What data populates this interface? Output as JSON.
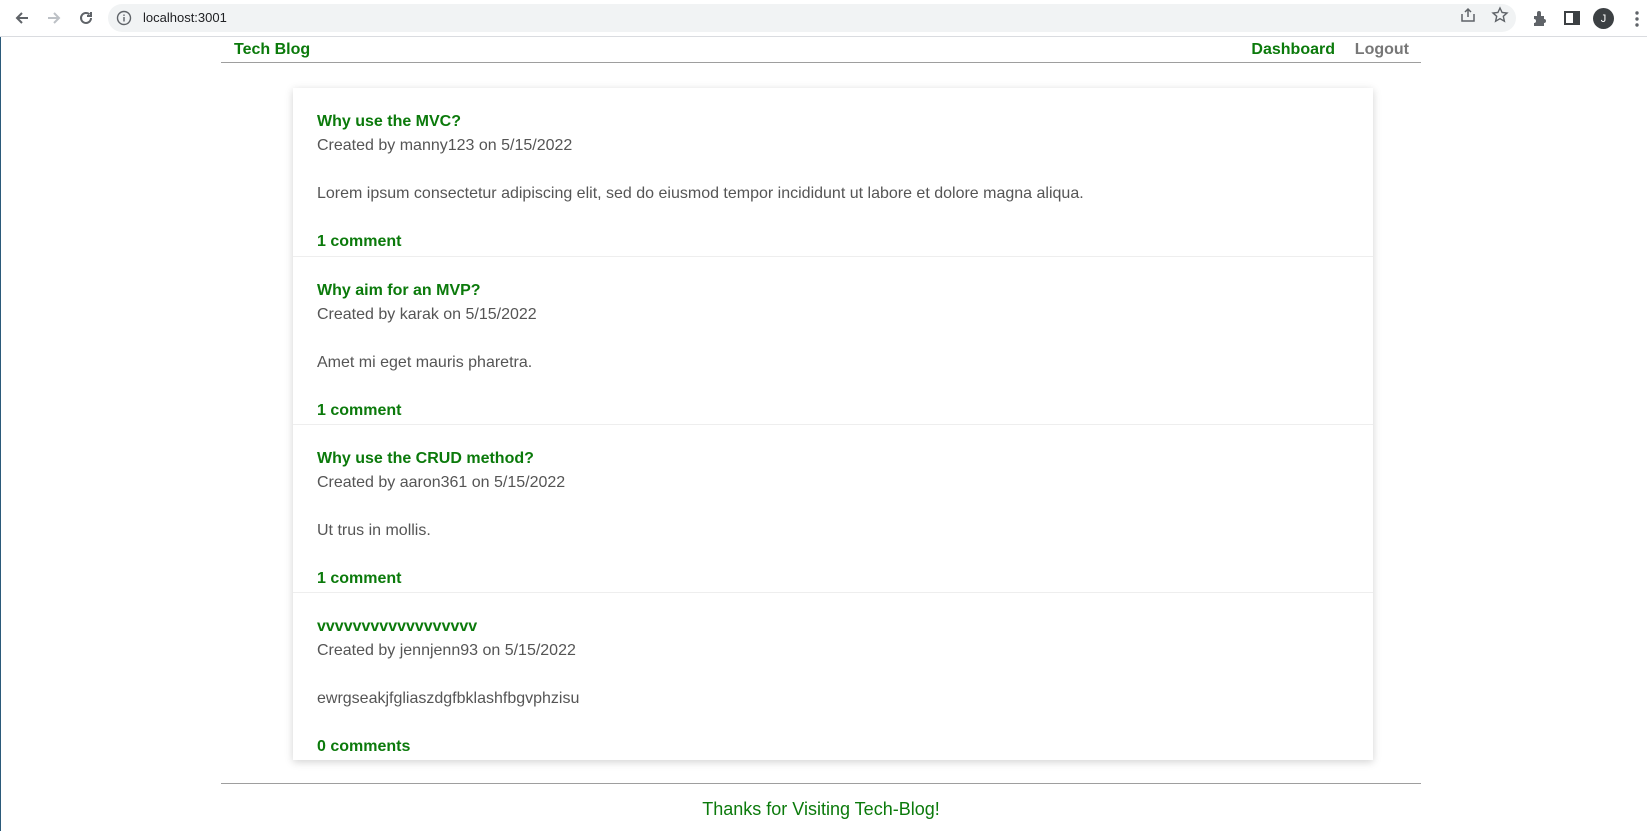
{
  "browser": {
    "url": "localhost:3001",
    "profile_initial": "J",
    "icons": [
      "back-icon",
      "forward-icon",
      "reload-icon",
      "info-icon",
      "share-icon",
      "star-icon",
      "extensions-icon",
      "side-panel-icon",
      "kebab-menu-icon"
    ]
  },
  "header": {
    "brand": "Tech Blog",
    "nav": {
      "dashboard": "Dashboard",
      "logout": "Logout"
    }
  },
  "posts": [
    {
      "title": "Why use the MVC?",
      "meta": "Created by manny123 on 5/15/2022",
      "body": "Lorem ipsum consectetur adipiscing elit, sed do eiusmod tempor incididunt ut labore et dolore magna aliqua.",
      "comments": "1 comment"
    },
    {
      "title": "Why aim for an MVP?",
      "meta": "Created by karak on 5/15/2022",
      "body": "Amet mi eget mauris pharetra.",
      "comments": "1 comment"
    },
    {
      "title": "Why use the CRUD method?",
      "meta": "Created by aaron361 on 5/15/2022",
      "body": "Ut trus in mollis.",
      "comments": "1 comment"
    },
    {
      "title": "vvvvvvvvvvvvvvvvvv",
      "meta": "Created by jennjenn93 on 5/15/2022",
      "body": "ewrgseakjfgliaszdgfbklashfbgvphzisu",
      "comments": "0 comments"
    }
  ],
  "footer": {
    "text": "Thanks for Visiting Tech-Blog!"
  },
  "colors": {
    "accent": "#0b7a0b",
    "muted_text": "#555555",
    "logout": "#777777"
  }
}
